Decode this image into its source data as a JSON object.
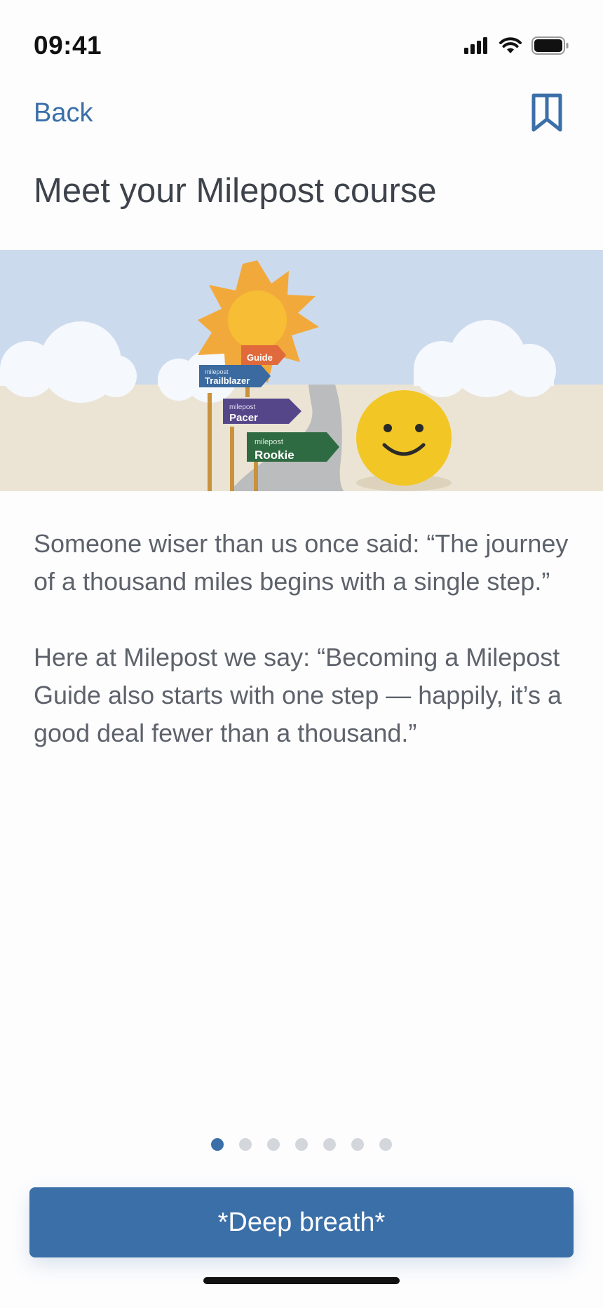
{
  "status_bar": {
    "time": "09:41",
    "icons": [
      "signal-icon",
      "wifi-icon",
      "battery-icon"
    ]
  },
  "nav": {
    "back_label": "Back",
    "bookmark_icon": "bookmark-icon"
  },
  "page": {
    "title": "Meet your Milepost course"
  },
  "hero": {
    "signs": [
      {
        "small": "",
        "label": "Guide"
      },
      {
        "small": "milepost",
        "label": "Trailblazer"
      },
      {
        "small": "milepost",
        "label": "Pacer"
      },
      {
        "small": "milepost",
        "label": "Rookie"
      }
    ],
    "colors": {
      "sky": "#ccdaed",
      "ground": "#ebe4d4",
      "sun": "#f2a93b",
      "guide": "#e06a3b",
      "trailblazer": "#3a6aa0",
      "pacer": "#55468a",
      "rookie": "#2f6b42",
      "smiley": "#f2c625"
    }
  },
  "content": {
    "paragraphs": [
      "Someone wiser than us once said: “The journey of a thousand miles begins with a single step.”",
      "Here at Milepost we say: “Becoming a Milepost Guide also starts with one step — happily, it’s a good deal fewer than a thousand.”"
    ]
  },
  "pager": {
    "total": 7,
    "current": 1
  },
  "cta": {
    "label": "*Deep breath*"
  },
  "theme": {
    "accent": "#3b6fa8"
  }
}
